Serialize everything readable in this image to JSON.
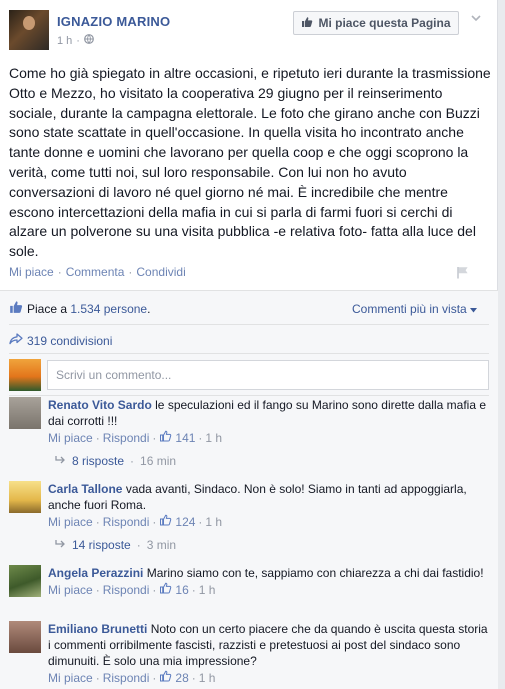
{
  "post": {
    "page_name": "IGNAZIO MARINO",
    "time": "1 h",
    "privacy_sep": "·",
    "like_page_label": "Mi piace questa Pagina",
    "text": "Come ho già spiegato in altre occasioni, e ripetuto ieri durante la trasmissione Otto e Mezzo, ho visitato la cooperativa 29 giugno per il reinserimento sociale, durante la campagna elettorale. Le foto che girano anche con Buzzi sono state scattate in quell'occasione. In quella visita ho incontrato anche tante donne e uomini che lavorano per quella coop e che oggi scoprono la verità, come tutti noi, sul loro responsabile. Con lui non ho avuto conversazioni di lavoro né quel giorno né mai. È incredibile che mentre escono intercettazioni della mafia in cui si parla di farmi fuori si cerchi di alzare un polverone su una visita pubblica -e relativa foto- fatta alla luce del sole.",
    "actions": {
      "like": "Mi piace",
      "comment": "Commenta",
      "share": "Condividi",
      "sep": "·"
    }
  },
  "ufi": {
    "likes_prefix": "Piace a ",
    "likes_count": "1.534 persone",
    "likes_suffix": ".",
    "sort_label": "Commenti più in vista",
    "shares_label": "319 condivisioni",
    "compose_placeholder": "Scrivi un commento..."
  },
  "comments": [
    {
      "name": "Renato Vito Sardo",
      "text": "le speculazioni ed il fango su Marino sono dirette dalla mafia e dai corrotti !!!",
      "like": "Mi piace",
      "reply": "Rispondi",
      "likes": "141",
      "time": "1 h",
      "replies": "8 risposte",
      "replies_time": "16 min"
    },
    {
      "name": "Carla Tallone",
      "text": "vada avanti, Sindaco. Non è solo! Siamo in tanti ad appoggiarla, anche fuori Roma.",
      "like": "Mi piace",
      "reply": "Rispondi",
      "likes": "124",
      "time": "1 h",
      "replies": "14 risposte",
      "replies_time": "3 min"
    },
    {
      "name": "Angela Perazzini",
      "text": "Marino siamo con te, sappiamo con chiarezza a chi dai fastidio!",
      "like": "Mi piace",
      "reply": "Rispondi",
      "likes": "16",
      "time": "1 h"
    },
    {
      "name": "Emiliano Brunetti",
      "text": "Noto con un certo piacere che da quando è uscita questa storia i commenti orribilmente fascisti, razzisti e pretestuosi ai post del sindaco sono dimunuiti. È solo una mia impressione?",
      "like": "Mi piace",
      "reply": "Rispondi",
      "likes": "28",
      "time": "1 h"
    }
  ],
  "colors": {
    "link": "#3b5998",
    "meta": "#9197a3",
    "ufi_bg": "#f6f7f9"
  }
}
